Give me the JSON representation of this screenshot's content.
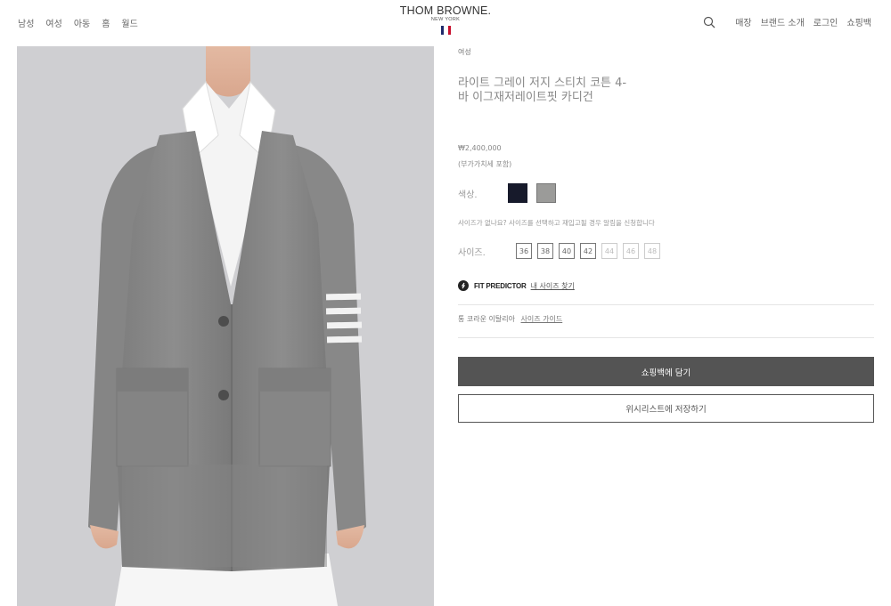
{
  "header": {
    "nav_left": [
      "남성",
      "여성",
      "아동",
      "홈",
      "월드"
    ],
    "logo_main": "THOM BROWNE.",
    "logo_sub": "NEW YORK",
    "nav_right": [
      "매장",
      "브랜드 소개",
      "로그인",
      "쇼핑백"
    ]
  },
  "product": {
    "category": "여성",
    "title": "라이트 그레이 저지 스티치 코튼 4-바 이그재저레이트핏 카디건",
    "price": "₩2,400,000",
    "vat_note": "(부가가치세 포함)",
    "color_label": "색상.",
    "colors": [
      {
        "name": "navy",
        "hex": "#171a2b"
      },
      {
        "name": "light-grey",
        "hex": "#9b9b99",
        "selected": true
      }
    ],
    "size_note": "사이즈가 없나요? 사이즈를 선택하고 재입고될 경우 알림을 신청합니다",
    "size_label": "사이즈.",
    "sizes": [
      {
        "label": "36",
        "available": true
      },
      {
        "label": "38",
        "available": true
      },
      {
        "label": "40",
        "available": true
      },
      {
        "label": "42",
        "available": true
      },
      {
        "label": "44",
        "available": false
      },
      {
        "label": "46",
        "available": false
      },
      {
        "label": "48",
        "available": false
      }
    ],
    "fit_predictor": "FIT PREDICTOR",
    "fit_link": "내 사이즈 찾기",
    "origin": "통 코라운 이탈리아",
    "size_guide": "사이즈 가이드",
    "add_to_bag": "쇼핑백에 담기",
    "save_wishlist": "위시리스트에 저장하기"
  },
  "colors": {
    "flag_blue": "#1f2a6b",
    "flag_red": "#c8102e",
    "button_dark": "#545454"
  }
}
